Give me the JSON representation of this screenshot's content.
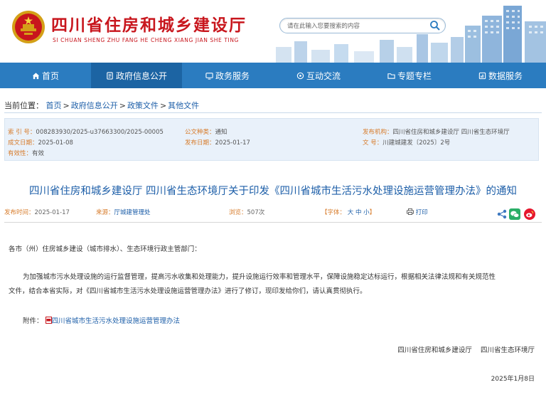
{
  "header": {
    "title": "四川省住房和城乡建设厅",
    "subtitle": "SI CHUAN SHENG ZHU FANG HE CHENG XIANG JIAN SHE TING",
    "search_placeholder": "请在此输入您要搜索的内容"
  },
  "nav": {
    "items": [
      {
        "label": "首页",
        "icon": "home-icon"
      },
      {
        "label": "政府信息公开",
        "icon": "document-icon"
      },
      {
        "label": "政务服务",
        "icon": "monitor-icon"
      },
      {
        "label": "互动交流",
        "icon": "chat-icon"
      },
      {
        "label": "专题专栏",
        "icon": "folder-icon"
      },
      {
        "label": "数据服务",
        "icon": "data-icon"
      }
    ],
    "active_index": 1
  },
  "breadcrumb": {
    "prefix": "当前位置：",
    "items": [
      "首页",
      "政府信息公开",
      "政策文件",
      "其他文件"
    ],
    "separator": ">"
  },
  "meta": {
    "index_label": "索 引 号：",
    "index_value": "008283930/2025-u37663300/2025-00005",
    "category_label": "公文种类：",
    "category_value": "通知",
    "issuer_label": "发布机构：",
    "issuer_value": "四川省住房和城乡建设厅 四川省生态环境厅",
    "created_label": "成文日期：",
    "created_value": "2025-01-08",
    "published_label": "发布日期：",
    "published_value": "2025-01-17",
    "docno_label": "文 号：",
    "docno_value": "川建城建发〔2025〕2号",
    "validity_label": "有效性：",
    "validity_value": "有效"
  },
  "document": {
    "title": "四川省住房和城乡建设厅 四川省生态环境厅关于印发《四川省城市生活污水处理设施运营管理办法》的通知",
    "publish_time_label": "发布时间：",
    "publish_time_value": "2025-01-17",
    "source_label": "来源：",
    "source_value": "厅城建管理处",
    "views_label": "浏览：",
    "views_value": "507次",
    "font_label": "【字体：",
    "font_large": "大",
    "font_medium": "中",
    "font_small": "小",
    "font_close": "】",
    "print_label": "打印",
    "salutation": "各市（州）住房城乡建设（城市排水）、生态环境行政主管部门：",
    "paragraph_line1": "为加强城市污水处理设施的运行监督管理，提高污水收集和处理能力，提升设施运行效率和管理水平，保障设施稳定达标运行，根据相关法律法规和有关规范性",
    "paragraph_line2": "文件，结合本省实际，对《四川省城市生活污水处理设施运营管理办法》进行了修订，现印发给你们，请认真贯彻执行。",
    "attachment_label": "附件：",
    "attachment_link": "四川省城市生活污水处理设施运营管理办法",
    "signature": "四川省住房和城乡建设厅    四川省生态环境厅",
    "date": "2025年1月8日"
  },
  "colors": {
    "brand_red": "#c8161d",
    "nav_blue": "#2b7cc0",
    "nav_active": "#1c64a3",
    "link_blue": "#1c5ea8",
    "label_orange": "#d77b2a",
    "meta_bg": "#e9f1fa"
  }
}
